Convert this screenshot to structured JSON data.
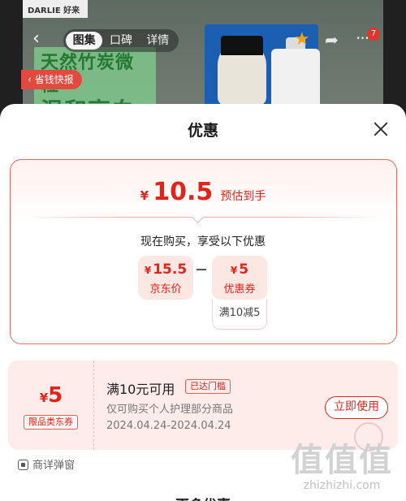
{
  "product_header": {
    "brand_text": "DARLIE 好来",
    "promo_line1": "天然竹炭微粒",
    "promo_line2": "温和亮白",
    "tabs": [
      "图集",
      "口碑",
      "详情"
    ],
    "active_tab": 0,
    "notification_count": "7",
    "quick_tag": "‹ 省钱快报",
    "icons": {
      "back": "chevron-left-icon",
      "favorite": "star-icon",
      "share": "share-icon",
      "more": "more-dots-icon"
    },
    "colors": {
      "favorite": "#f0a21b",
      "badge": "#e0362e"
    }
  },
  "sheet": {
    "title": "优惠",
    "estimate": {
      "currency": "¥",
      "amount": "10.5",
      "note": "预估到手"
    },
    "intro": "现在购买，享受以下优惠",
    "breakdown": [
      {
        "currency": "¥",
        "value": "15.5",
        "label": "京东价"
      },
      {
        "currency": "¥",
        "value": "5",
        "label": "优惠券"
      }
    ],
    "operator": "-",
    "coupon_condition": "满10减5",
    "coupon": {
      "currency": "¥",
      "value": "5",
      "kind": "限品类东券",
      "title": "满10元可用",
      "status_tag": "已达门槛",
      "description": "仅可购买个人护理部分商品",
      "validity": "2024.04.24-2024.04.24",
      "action": "立即使用"
    },
    "detail_popup_label": "商详弹窗",
    "next_section_title": "更多优惠",
    "accent_color": "#e2231a"
  },
  "watermark": {
    "mark": "值值值",
    "url": "zhizhizhi.com"
  }
}
